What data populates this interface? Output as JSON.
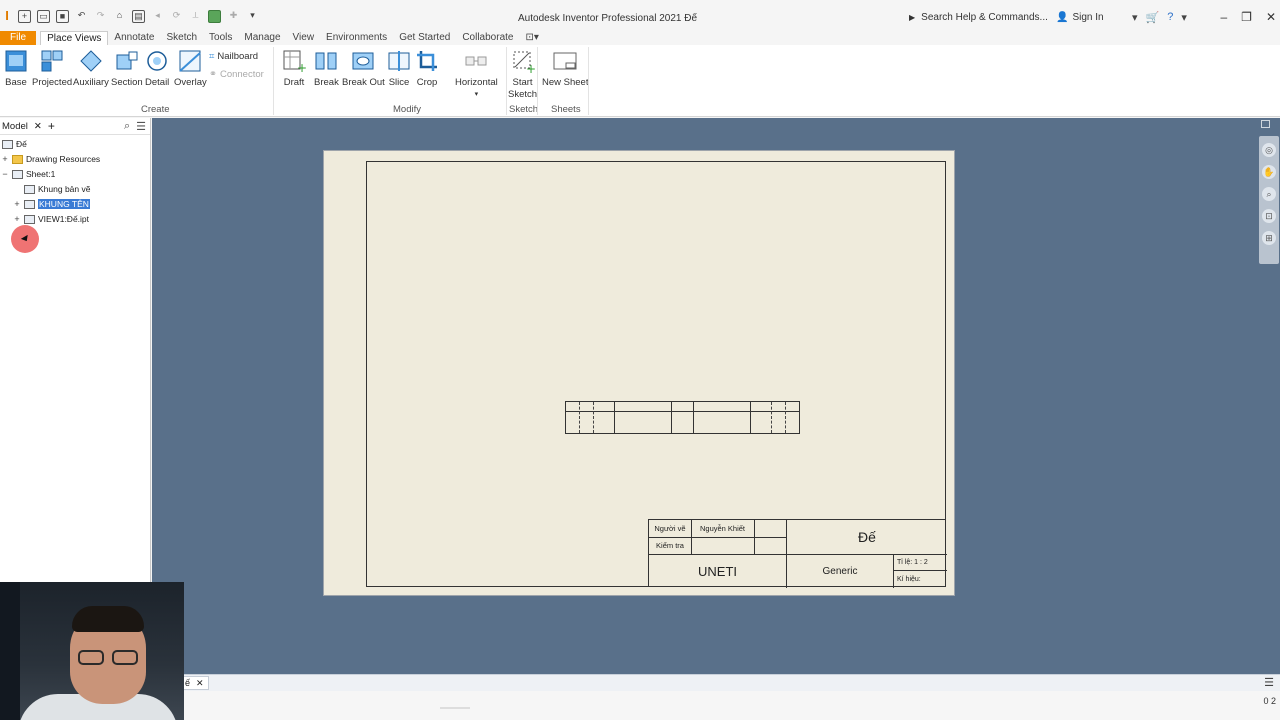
{
  "titlebar": {
    "app_title": "Autodesk Inventor Professional 2021   Đế",
    "search_placeholder": "Search Help & Commands...",
    "sign_in": "Sign In"
  },
  "tabs": [
    "File",
    "Place Views",
    "Annotate",
    "Sketch",
    "Tools",
    "Manage",
    "View",
    "Environments",
    "Get Started",
    "Collaborate"
  ],
  "active_tab": "Place Views",
  "ribbon": {
    "create": {
      "label": "Create",
      "buttons": [
        "Base",
        "Projected",
        "Auxiliary",
        "Section",
        "Detail",
        "Overlay"
      ],
      "small": [
        "Nailboard",
        "Connector"
      ]
    },
    "modify": {
      "label": "Modify",
      "buttons": [
        "Draft",
        "Break",
        "Break Out",
        "Slice",
        "Crop",
        "Horizontal"
      ]
    },
    "sketch": {
      "label": "Sketch",
      "button_line1": "Start",
      "button_line2": "Sketch"
    },
    "sheets": {
      "label": "Sheets",
      "button": "New Sheet"
    }
  },
  "browser": {
    "tab": "Model",
    "root": "Đế",
    "nodes": [
      "Drawing Resources",
      "Sheet:1",
      "Khung bản vẽ",
      "KHUNG TÊN",
      "VIEW1:Đế.ipt"
    ]
  },
  "title_block": {
    "drawn_by_label": "Người vẽ",
    "drawn_by": "Nguyễn Khiết",
    "checked_label": "Kiểm tra",
    "part_name": "Đế",
    "school": "UNETI",
    "material": "Generic",
    "scale": "Tỉ lệ: 1 : 2",
    "symbol": "Kí hiệu:"
  },
  "status": {
    "doc_tab": "ế",
    "numbers": "0   2"
  },
  "colors": {
    "canvas": "#59708a",
    "sheet": "#efebdc",
    "file_tab": "#f08a00",
    "selection": "#3a7bd5"
  }
}
